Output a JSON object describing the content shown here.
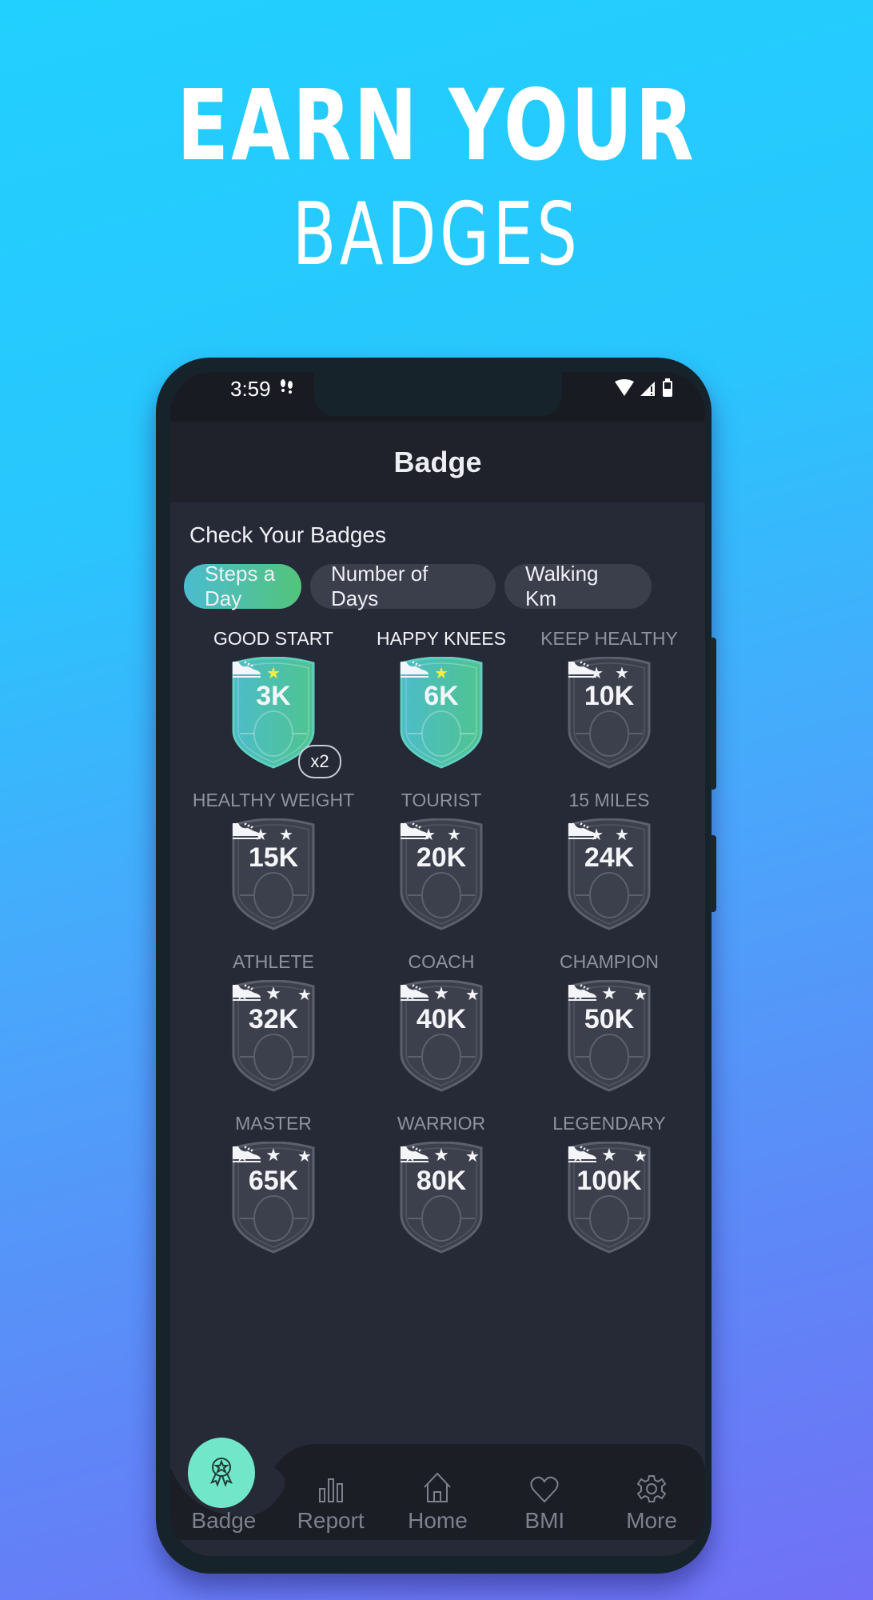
{
  "promo": {
    "headline_line1": "EARN YOUR",
    "headline_line2": "BADGES"
  },
  "status_bar": {
    "time": "3:59",
    "icons": [
      "footsteps-icon",
      "wifi-icon",
      "signal-icon",
      "battery-icon"
    ]
  },
  "app_bar": {
    "title": "Badge"
  },
  "section": {
    "title": "Check Your Badges"
  },
  "tabs": [
    {
      "label": "Steps a Day",
      "active": true
    },
    {
      "label": "Number of Days",
      "active": false
    },
    {
      "label": "Walking Km",
      "active": false
    }
  ],
  "badges": [
    {
      "name": "GOOD START",
      "value": "3K",
      "stars": 1,
      "earned": true,
      "multiplier": "x2"
    },
    {
      "name": "HAPPY KNEES",
      "value": "6K",
      "stars": 1,
      "earned": true
    },
    {
      "name": "KEEP HEALTHY",
      "value": "10K",
      "stars": 2,
      "earned": false
    },
    {
      "name": "HEALTHY WEIGHT",
      "value": "15K",
      "stars": 2,
      "earned": false
    },
    {
      "name": "TOURIST",
      "value": "20K",
      "stars": 2,
      "earned": false
    },
    {
      "name": "15 MILES",
      "value": "24K",
      "stars": 2,
      "earned": false
    },
    {
      "name": "ATHLETE",
      "value": "32K",
      "stars": 3,
      "earned": false
    },
    {
      "name": "COACH",
      "value": "40K",
      "stars": 3,
      "earned": false
    },
    {
      "name": "CHAMPION",
      "value": "50K",
      "stars": 3,
      "earned": false
    },
    {
      "name": "MASTER",
      "value": "65K",
      "stars": 3,
      "earned": false
    },
    {
      "name": "WARRIOR",
      "value": "80K",
      "stars": 3,
      "earned": false
    },
    {
      "name": "LEGENDARY",
      "value": "100K",
      "stars": 3,
      "earned": false
    }
  ],
  "bottom_nav": [
    {
      "label": "Badge",
      "icon": "ribbon-badge-icon",
      "active": true
    },
    {
      "label": "Report",
      "icon": "bar-chart-icon",
      "active": false
    },
    {
      "label": "Home",
      "icon": "home-icon",
      "active": false
    },
    {
      "label": "BMI",
      "icon": "heart-icon",
      "active": false
    },
    {
      "label": "More",
      "icon": "gear-icon",
      "active": false
    }
  ],
  "colors": {
    "accent_teal": "#72e6c9",
    "tab_active_start": "#4bbcd0",
    "tab_active_end": "#53c47a",
    "star_earned": "#f6ec46",
    "screen_bg": "#262936"
  }
}
